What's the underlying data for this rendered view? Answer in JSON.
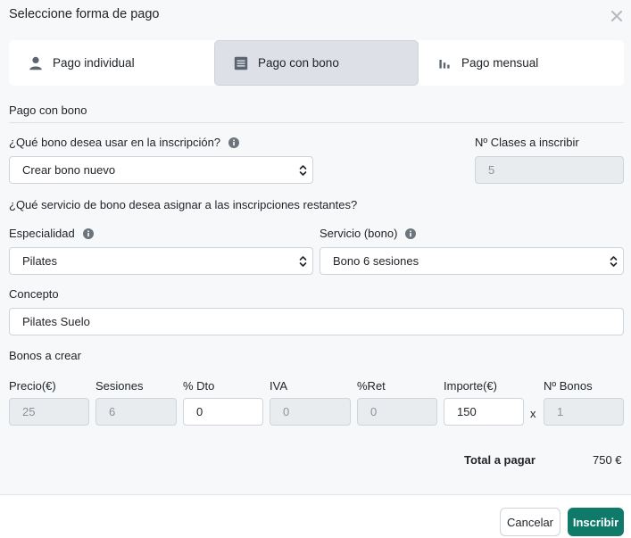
{
  "modal": {
    "title": "Seleccione forma de pago"
  },
  "tabs": [
    {
      "label": "Pago individual",
      "icon": "person-icon"
    },
    {
      "label": "Pago con bono",
      "icon": "receipt-icon",
      "active": true
    },
    {
      "label": "Pago mensual",
      "icon": "bar-chart-icon"
    }
  ],
  "section": {
    "title": "Pago con bono"
  },
  "bono": {
    "question": "¿Qué bono desea usar en la inscripción?",
    "selected": "Crear bono nuevo"
  },
  "clases": {
    "label": "Nº Clases a inscribir",
    "value": "5"
  },
  "servicio_question": "¿Qué servicio de bono desea asignar a las inscripciones restantes?",
  "especialidad": {
    "label": "Especialidad",
    "selected": "Pilates"
  },
  "servicio": {
    "label": "Servicio (bono)",
    "selected": "Bono 6 sesiones"
  },
  "concepto": {
    "label": "Concepto",
    "value": "Pilates Suelo"
  },
  "bonos": {
    "title": "Bonos a crear",
    "columns": {
      "precio": "Precio(€)",
      "sesiones": "Sesiones",
      "dto": "% Dto",
      "iva": "IVA",
      "ret": "%Ret",
      "importe": "Importe(€)",
      "num": "Nº Bonos"
    },
    "values": {
      "precio": "25",
      "sesiones": "6",
      "dto": "0",
      "iva": "0",
      "ret": "0",
      "importe": "150",
      "num": "1"
    },
    "multiplier": "x"
  },
  "total": {
    "label": "Total a pagar",
    "value": "750 €"
  },
  "buttons": {
    "cancel": "Cancelar",
    "submit": "Inscribir"
  },
  "colors": {
    "primary": "#0f7a6a",
    "active_tab": "#dde0e6",
    "background": "#f7f8fa"
  }
}
